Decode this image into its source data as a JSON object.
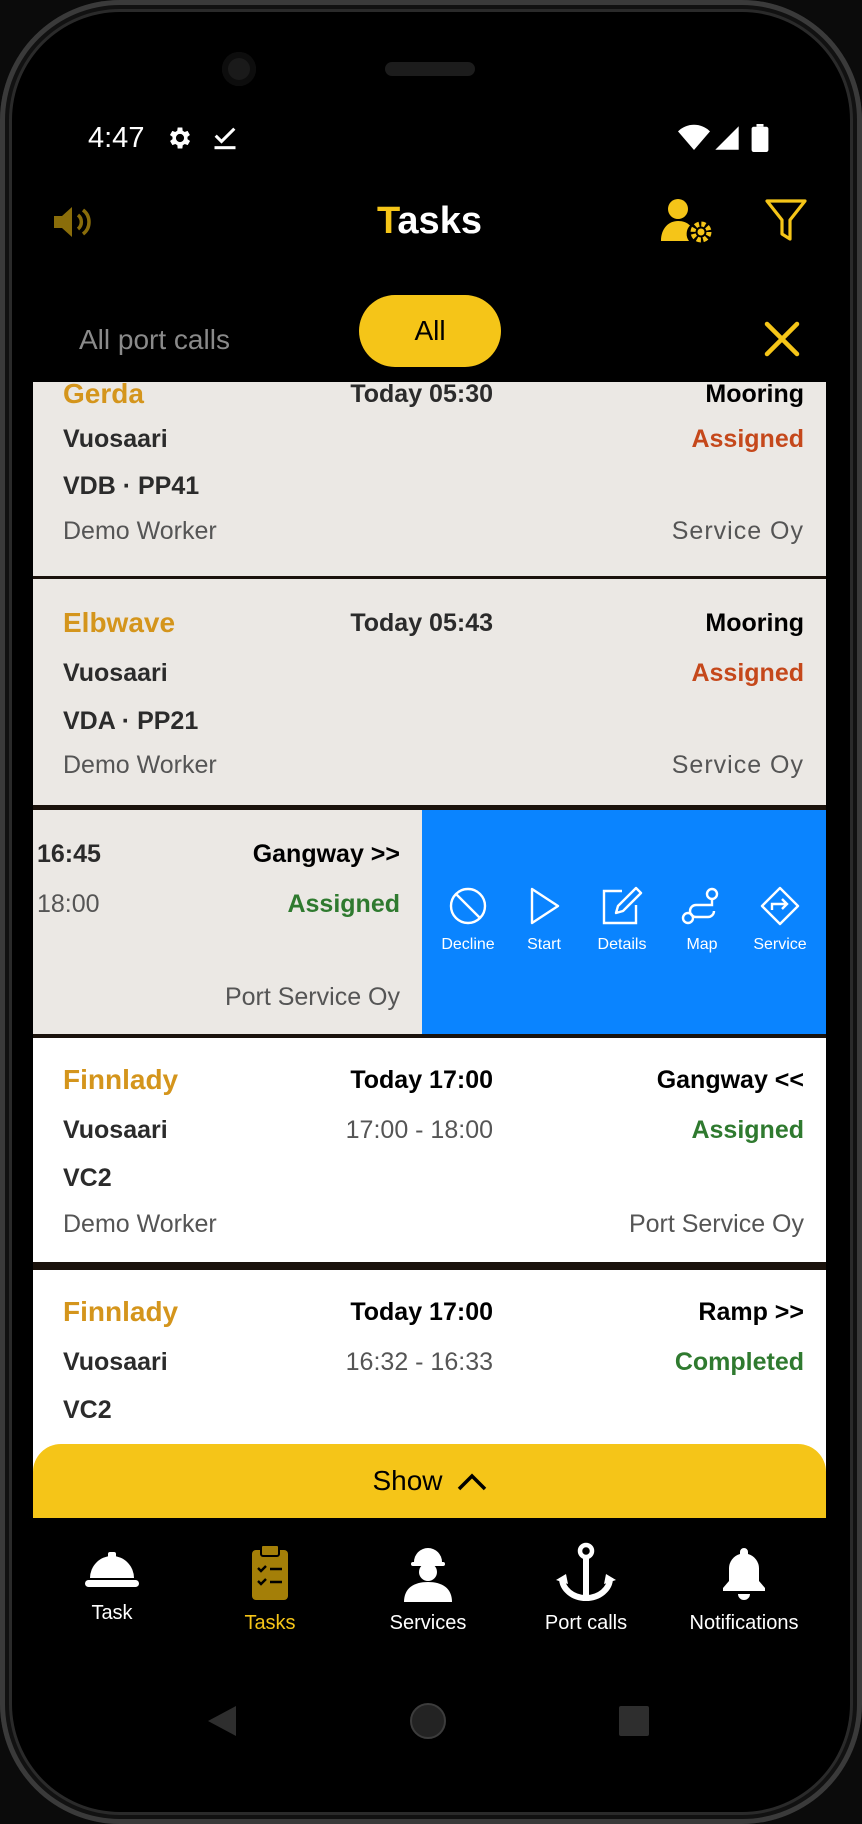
{
  "status": {
    "time": "4:47"
  },
  "header": {
    "title_first": "T",
    "title_rest": "asks"
  },
  "filter": {
    "all_port_calls": "All port calls",
    "all": "All"
  },
  "cards": [
    {
      "vessel": "Gerda",
      "time": "Today 05:30",
      "task": "Mooring",
      "port": "Vuosaari",
      "status": "Assigned",
      "berth": "VDB · PP41",
      "worker": "Demo Worker",
      "company": "Service Oy"
    },
    {
      "vessel": "Elbwave",
      "time": "Today 05:43",
      "task": "Mooring",
      "port": "Vuosaari",
      "status": "Assigned",
      "berth": "VDA · PP21",
      "worker": "Demo Worker",
      "company": "Service Oy"
    },
    {
      "vessel": "Finnlady",
      "time": "Today 17:00",
      "task": "Gangway <<",
      "port": "Vuosaari",
      "range": "17:00 - 18:00",
      "status": "Assigned",
      "berth": "VC2",
      "worker": "Demo Worker",
      "company": "Port Service Oy"
    },
    {
      "vessel": "Finnlady",
      "time": "Today 17:00",
      "task": "Ramp >>",
      "port": "Vuosaari",
      "range": "16:32 - 16:33",
      "status": "Completed",
      "berth": "VC2"
    }
  ],
  "swiped_card": {
    "time": "16:45",
    "task": "Gangway >>",
    "range_end": "18:00",
    "status": "Assigned",
    "company": "Port Service Oy"
  },
  "swipe_actions": [
    "Decline",
    "Start",
    "Details",
    "Map",
    "Service"
  ],
  "show_bar": {
    "label": "Show"
  },
  "bottom_nav": [
    "Task",
    "Tasks",
    "Services",
    "Port calls",
    "Notifications"
  ],
  "colors": {
    "accent": "#f5c518",
    "action_blue": "#0a84ff",
    "assigned_orange": "#c5481b",
    "assigned_green": "#2f7a2f",
    "vessel": "#d4951c"
  }
}
